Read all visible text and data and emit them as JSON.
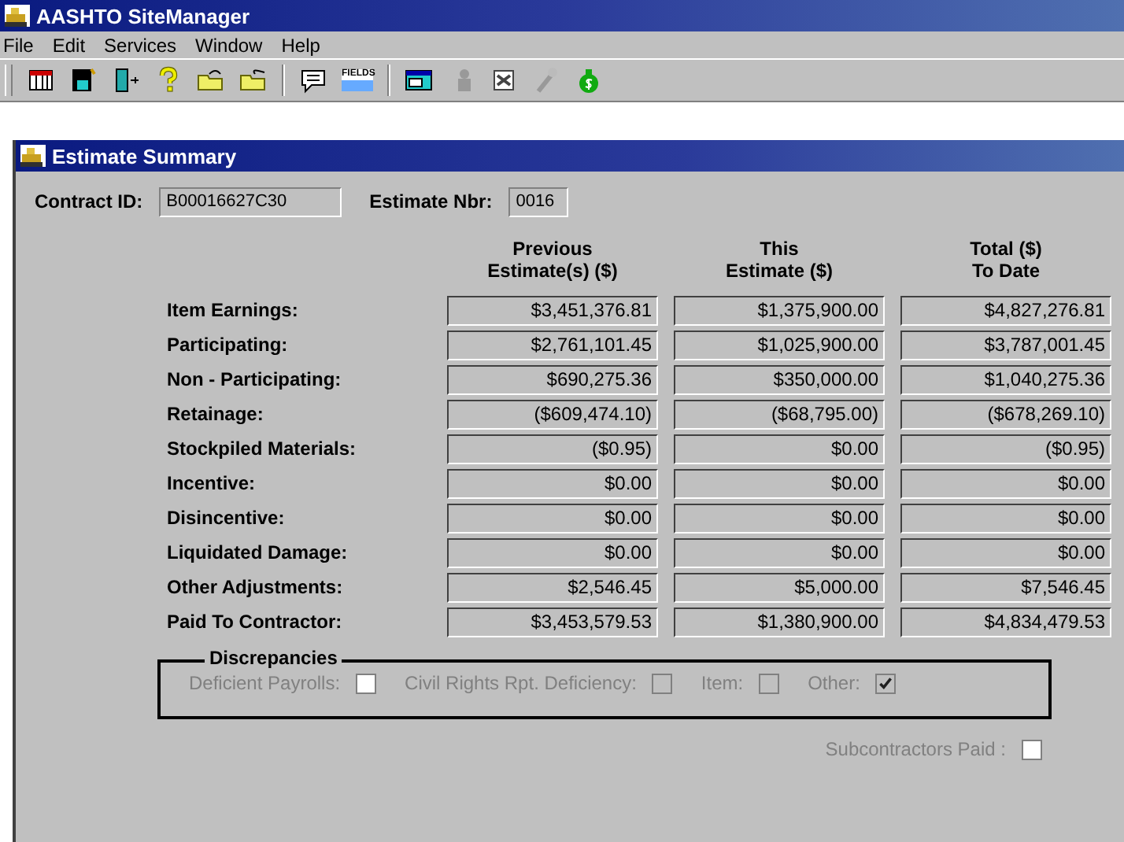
{
  "window": {
    "title": "AASHTO SiteManager"
  },
  "menu": [
    "File",
    "Edit",
    "Services",
    "Window",
    "Help"
  ],
  "toolbar": {
    "fields_label": "FIELDS"
  },
  "child_window": {
    "title": "Estimate Summary"
  },
  "contract_id": {
    "label": "Contract ID:",
    "value": "B00016627C30"
  },
  "estimate_nbr": {
    "label": "Estimate Nbr:",
    "value": "0016"
  },
  "columns": [
    "Previous\nEstimate(s) ($)",
    "This\nEstimate ($)",
    "Total ($)\nTo Date"
  ],
  "rows": [
    {
      "label": "Item Earnings:",
      "values": [
        "$3,451,376.81",
        "$1,375,900.00",
        "$4,827,276.81"
      ]
    },
    {
      "label": "Participating:",
      "values": [
        "$2,761,101.45",
        "$1,025,900.00",
        "$3,787,001.45"
      ]
    },
    {
      "label": "Non - Participating:",
      "values": [
        "$690,275.36",
        "$350,000.00",
        "$1,040,275.36"
      ]
    },
    {
      "label": "Retainage:",
      "values": [
        "($609,474.10)",
        "($68,795.00)",
        "($678,269.10)"
      ]
    },
    {
      "label": "Stockpiled Materials:",
      "values": [
        "($0.95)",
        "$0.00",
        "($0.95)"
      ]
    },
    {
      "label": "Incentive:",
      "values": [
        "$0.00",
        "$0.00",
        "$0.00"
      ]
    },
    {
      "label": "Disincentive:",
      "values": [
        "$0.00",
        "$0.00",
        "$0.00"
      ]
    },
    {
      "label": "Liquidated Damage:",
      "values": [
        "$0.00",
        "$0.00",
        "$0.00"
      ]
    },
    {
      "label": "Other Adjustments:",
      "values": [
        "$2,546.45",
        "$5,000.00",
        "$7,546.45"
      ]
    },
    {
      "label": "Paid To Contractor:",
      "values": [
        "$3,453,579.53",
        "$1,380,900.00",
        "$4,834,479.53"
      ]
    }
  ],
  "discrepancies": {
    "title": "Discrepancies",
    "items": [
      {
        "label": "Deficient Payrolls:",
        "checked": false,
        "disabled": true
      },
      {
        "label": "Civil Rights Rpt. Deficiency:",
        "checked": false,
        "disabled": true
      },
      {
        "label": "Item:",
        "checked": false,
        "disabled": true
      },
      {
        "label": "Other:",
        "checked": true,
        "disabled": true
      }
    ]
  },
  "subcontractors_paid": {
    "label": "Subcontractors Paid :",
    "checked": false,
    "disabled": true
  }
}
